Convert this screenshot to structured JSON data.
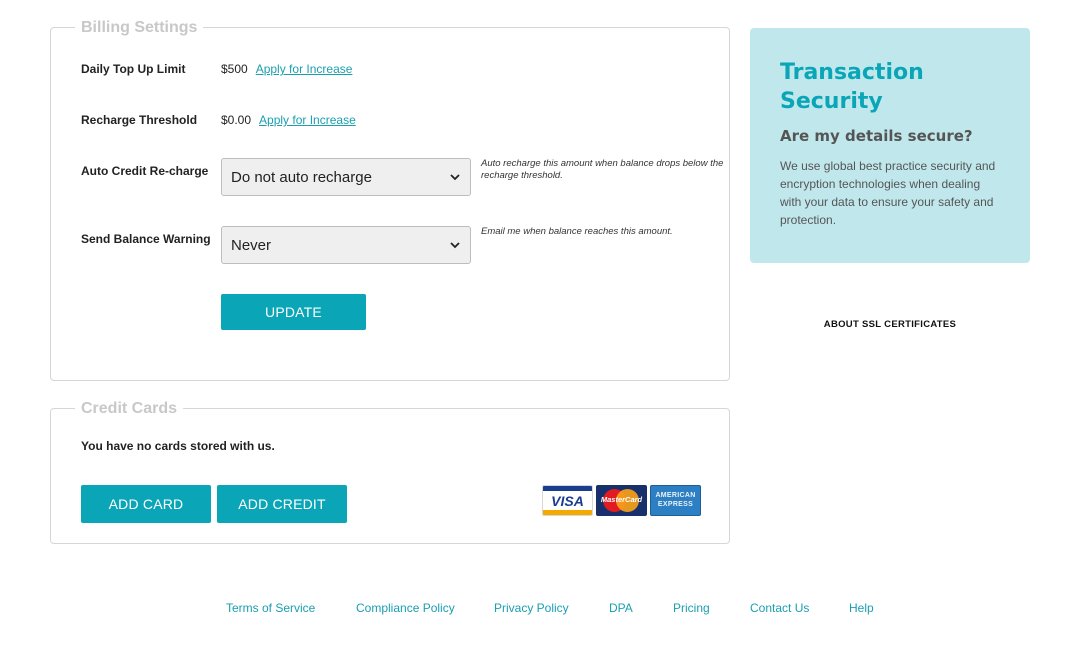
{
  "billing": {
    "legend": "Billing Settings",
    "daily_top_up": {
      "label": "Daily Top Up Limit",
      "value": "$500",
      "link": "Apply for Increase"
    },
    "recharge_threshold": {
      "label": "Recharge Threshold",
      "value": "$0.00",
      "link": "Apply for Increase"
    },
    "auto_credit": {
      "label": "Auto Credit Re-charge",
      "selected": "Do not auto recharge",
      "hint": "Auto recharge this amount when balance drops below the recharge threshold."
    },
    "balance_warning": {
      "label": "Send Balance Warning",
      "selected": "Never",
      "hint": "Email me when balance reaches this amount."
    },
    "update_label": "UPDATE"
  },
  "credit_cards": {
    "legend": "Credit Cards",
    "empty_text": "You have no cards stored with us.",
    "add_card_label": "ADD CARD",
    "add_credit_label": "ADD CREDIT",
    "logos": {
      "visa": "VISA",
      "mastercard": "MasterCard",
      "amex_line1": "AMERICAN",
      "amex_line2": "EXPRESS"
    }
  },
  "security": {
    "title": "Transaction Security",
    "subtitle": "Are my details secure?",
    "text": "We use global best practice security and encryption technologies when dealing with your data to ensure your safety and protection."
  },
  "ssl_link": "ABOUT SSL CERTIFICATES",
  "footer": {
    "terms": "Terms of Service",
    "compliance": "Compliance Policy",
    "privacy": "Privacy Policy",
    "dpa": "DPA",
    "pricing": "Pricing",
    "contact": "Contact Us",
    "help": "Help"
  },
  "colors": {
    "accent": "#0aa6b7",
    "security_bg": "#c0e8ec",
    "link": "#1a9fb0"
  },
  "icons": {
    "select_arrow": "chevron-down-icon"
  }
}
